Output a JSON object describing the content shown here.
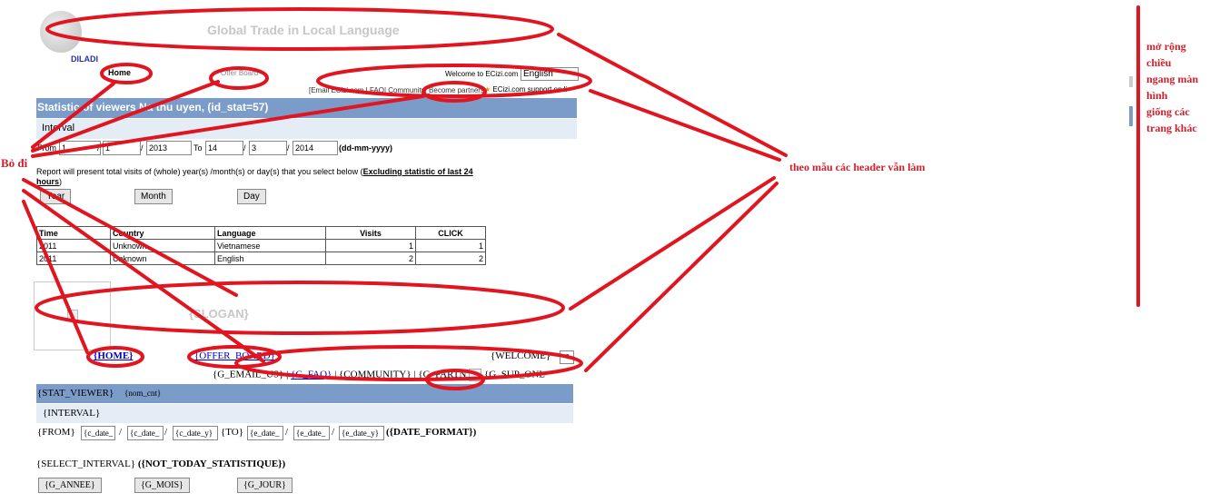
{
  "top": {
    "logo_text": "DILADI",
    "banner_title": "Global Trade in Local Language",
    "nav_home": "Home",
    "nav_offer": "Offer Board",
    "welcome": "Welcome to ECizi.com",
    "language": "English",
    "links": "[Email ECizi.com | FAQ| Community| Become partners",
    "support": "ECizi.com support on li"
  },
  "stat": {
    "title": "Statistic of viewers Na thu uyen, (id_stat=57)",
    "interval": "Interval",
    "from_label": "From",
    "from_day": "1",
    "from_month": "1",
    "from_year": "2013",
    "to_label": "To",
    "to_day": "14",
    "to_month": "3",
    "to_year": "2014",
    "sep": "/",
    "format": "(dd-mm-yyyy)",
    "note_pre": "Report will present total visits of (whole) year(s) /month(s) or day(s) that you select below (",
    "note_bold": "Excluding statistic of last 24 hours",
    "note_post": ")",
    "btn_year": "Year",
    "btn_month": "Month",
    "btn_day": "Day",
    "headers": [
      "Time",
      "Country",
      "Language",
      "Visits",
      "CLICK"
    ],
    "rows": [
      [
        "2011",
        "Unknown",
        "Vietnamese",
        "1",
        "1"
      ],
      [
        "2011",
        "Unknown",
        "English",
        "2",
        "2"
      ]
    ]
  },
  "tpl": {
    "slogan": "{SLOGAN}",
    "home": "{HOME}",
    "offer": "{OFFER_BOARD}",
    "welcome": "{WELCOME}",
    "email": "{G_EMAIL_US}",
    "faq": "{G_FAQ}",
    "community": "{COMMUNITY}",
    "partn": "{G_PARTN",
    "support": "{G_SUP_ONL",
    "stat_viewer": "{STAT_VIEWER}",
    "nom_cnt": "{nom_cnt}",
    "interval": "{INTERVAL}",
    "from": "{FROM}",
    "c_date": "{c_date_",
    "c_date2": "{c_date_",
    "c_date_y": "{c_date_y}",
    "to": "{TO}",
    "e_date": "{e_date_",
    "e_date2": "{e_date_",
    "e_date_y": "{e_date_y}",
    "date_format": "({DATE_FORMAT})",
    "select_interval": "{SELECT_INTERVAL}",
    "not_today": "({NOT_TODAY_STATISTIQUE})",
    "annee": "{G_ANNEE}",
    "mois": "{G_MOIS}",
    "jour": "{G_JOUR}"
  },
  "notes": {
    "remove": "Bỏ đi",
    "header_note": "theo mẫu các header vẫn làm",
    "right_note": [
      "mở rộng",
      "chiều",
      "ngang màn",
      "hình",
      "giống các",
      "trang khác"
    ]
  },
  "colors": {
    "annotation": "#e0151f",
    "bar": "#7b9cc9"
  }
}
